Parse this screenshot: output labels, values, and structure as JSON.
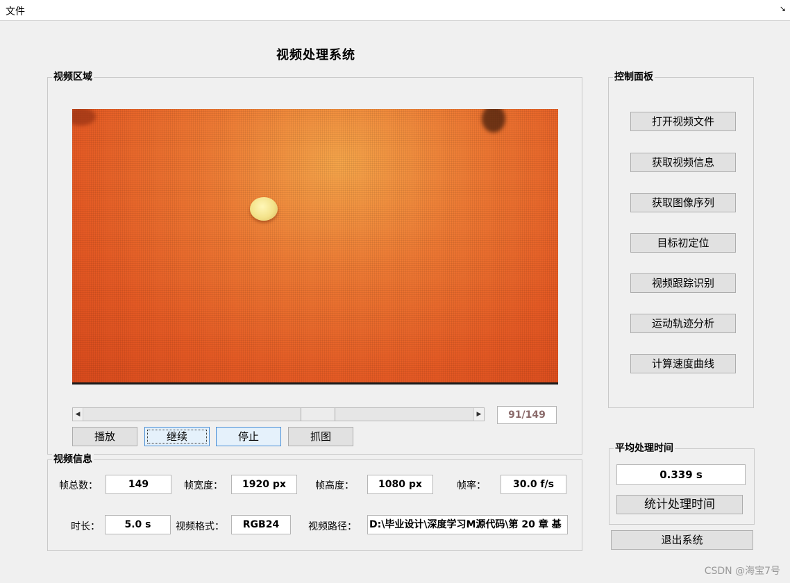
{
  "menu": {
    "file": "文件",
    "corner_icon": "↘"
  },
  "title": "视频处理系统",
  "video_panel": {
    "title": "视频区域",
    "frame_counter": "91/149",
    "slider_progress": 0.61,
    "buttons": {
      "play": "播放",
      "resume": "继续",
      "stop": "停止",
      "capture": "抓图"
    }
  },
  "info_panel": {
    "title": "视频信息",
    "total_frames_label": "帧总数：",
    "total_frames": "149",
    "width_label": "帧宽度：",
    "width": "1920 px",
    "height_label": "帧高度：",
    "height": "1080 px",
    "fps_label": "帧率：",
    "fps": "30.0 f/s",
    "duration_label": "时长：",
    "duration": "5.0 s",
    "format_label": "视频格式：",
    "format": "RGB24",
    "path_label": "视频路径：",
    "path": "D:\\毕业设计\\深度学习M源代码\\第 20 章 基"
  },
  "control_panel": {
    "title": "控制面板",
    "buttons": [
      "打开视频文件",
      "获取视频信息",
      "获取图像序列",
      "目标初定位",
      "视频跟踪识别",
      "运动轨迹分析",
      "计算速度曲线"
    ]
  },
  "time_panel": {
    "title": "平均处理时间",
    "value": "0.339 s",
    "button": "统计处理时间"
  },
  "exit_button": "退出系统",
  "watermark": "CSDN @海宝7号"
}
